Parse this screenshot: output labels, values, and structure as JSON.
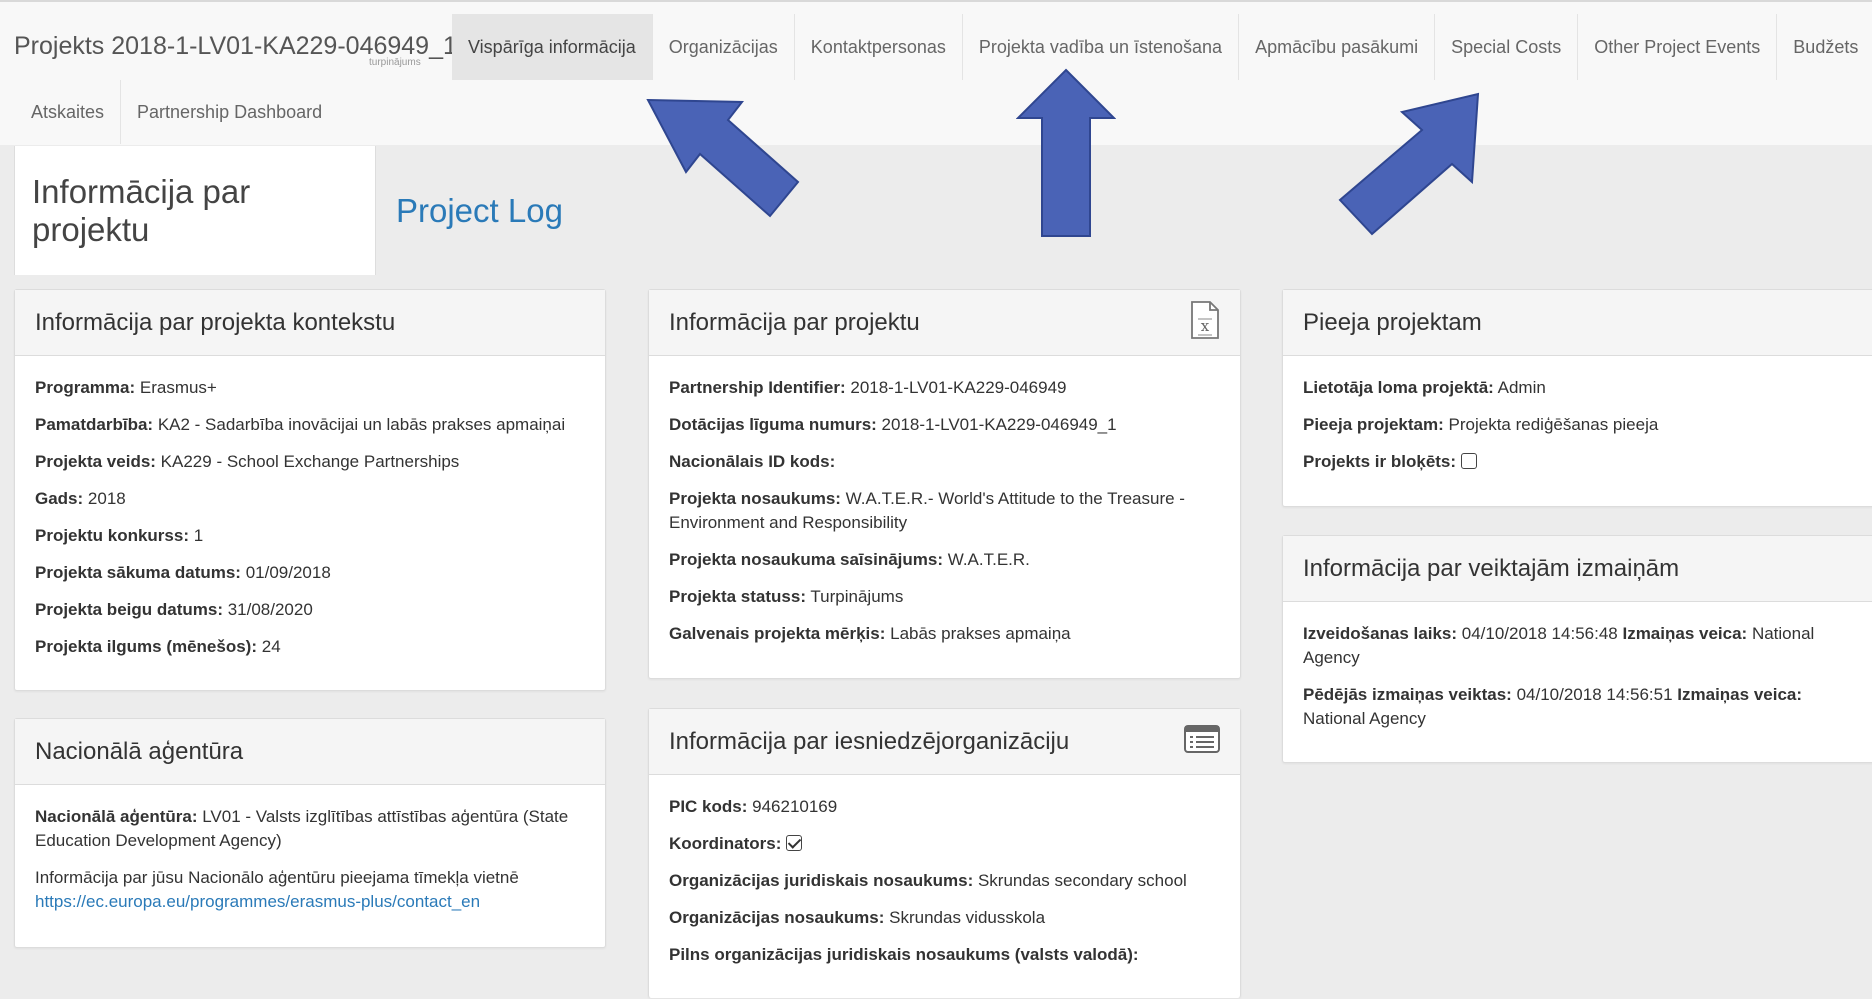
{
  "brand": {
    "title": "Projekts 2018-1-LV01-KA229-046949_1",
    "subtitle": "turpinājums"
  },
  "nav_row1": [
    {
      "label": "Vispārīga informācija",
      "active": true
    },
    {
      "label": "Organizācijas"
    },
    {
      "label": "Kontaktpersonas"
    },
    {
      "label": "Projekta vadība un īstenošana"
    },
    {
      "label": "Apmācību pasākumi"
    },
    {
      "label": "Special Costs"
    },
    {
      "label": "Other Project Events"
    },
    {
      "label": "Budžets"
    }
  ],
  "nav_row2": [
    {
      "label": "Atskaites"
    },
    {
      "label": "Partnership Dashboard"
    }
  ],
  "tabs": {
    "info": "Informācija par projektu",
    "log": "Project Log"
  },
  "context": {
    "title": "Informācija par projekta kontekstu",
    "fields": [
      {
        "label": "Programma:",
        "value": " Erasmus+"
      },
      {
        "label": "Pamatdarbība:",
        "value": " KA2 - Sadarbība inovācijai un labās prakses apmaiņai"
      },
      {
        "label": "Projekta veids:",
        "value": " KA229 - School Exchange Partnerships"
      },
      {
        "label": "Gads:",
        "value": " 2018"
      },
      {
        "label": "Projektu konkurss:",
        "value": " 1"
      },
      {
        "label": "Projekta sākuma datums:",
        "value": " 01/09/2018"
      },
      {
        "label": "Projekta beigu datums:",
        "value": " 31/08/2020"
      },
      {
        "label": "Projekta ilgums (mēnešos):",
        "value": " 24"
      }
    ]
  },
  "agency": {
    "title": "Nacionālā aģentūra",
    "label": "Nacionālā aģentūra:",
    "value": " LV01 - Valsts izglītības attīstības aģentūra (State Education Development Agency)",
    "note": "Informācija par jūsu Nacionālo aģentūru pieejama tīmekļa vietnē",
    "link": "https://ec.europa.eu/programmes/erasmus-plus/contact_en"
  },
  "project": {
    "title": "Informācija par projektu",
    "fields": [
      {
        "label": "Partnership Identifier:",
        "value": " 2018-1-LV01-KA229-046949"
      },
      {
        "label": "Dotācijas līguma numurs:",
        "value": " 2018-1-LV01-KA229-046949_1"
      },
      {
        "label": "Nacionālais ID kods:",
        "value": ""
      },
      {
        "label": "Projekta nosaukums:",
        "value": " W.A.T.E.R.- World's Attitude to the Treasure - Environment and Responsibility"
      },
      {
        "label": "Projekta nosaukuma saīsinājums:",
        "value": " W.A.T.E.R."
      },
      {
        "label": "Projekta statuss:",
        "value": " Turpinājums"
      },
      {
        "label": "Galvenais projekta mērķis:",
        "value": " Labās prakses apmaiņa"
      }
    ]
  },
  "applicant": {
    "title": "Informācija par iesniedzējorganizāciju",
    "pic_label": "PIC kods:",
    "pic_value": " 946210169",
    "coord_label": "Koordinators:",
    "coord_checked": true,
    "legal_label": "Organizācijas juridiskais nosaukums:",
    "legal_value": " Skrundas secondary school",
    "name_label": "Organizācijas nosaukums:",
    "name_value": " Skrundas vidusskola",
    "full_label": "Pilns organizācijas juridiskais nosaukums (valsts valodā):"
  },
  "access": {
    "title": "Pieeja projektam",
    "role_label": "Lietotāja loma projektā:",
    "role_value": " Admin",
    "access_label": "Pieeja projektam:",
    "access_value": " Projekta rediģēšanas pieeja",
    "locked_label": "Projekts ir bloķēts:",
    "locked": false
  },
  "changes": {
    "title": "Informācija par veiktajām izmaiņām",
    "created_label": "Izveidošanas laiks:",
    "created_value": " 04/10/2018 14:56:48 ",
    "created_by_label": "Izmaiņas veica:",
    "created_by_value": " National Agency",
    "last_label": "Pēdējās izmaiņas veiktas:",
    "last_value": " 04/10/2018 14:56:51 ",
    "last_by_label": "Izmaiņas veica:",
    "last_by_value": " National Agency"
  },
  "icons": {
    "excel": "excel-file-icon",
    "list": "list-icon",
    "arrow_color": "#4a63b6"
  }
}
